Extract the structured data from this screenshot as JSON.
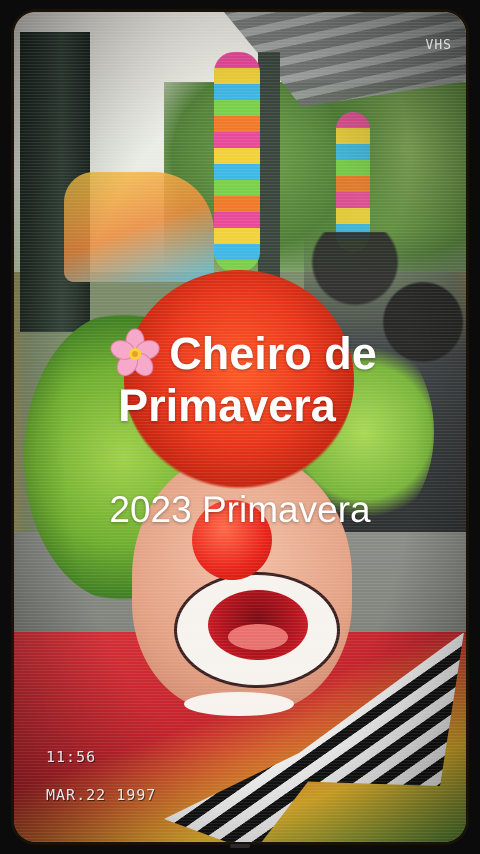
{
  "overlay": {
    "vhs_label": "VHS",
    "title_line1": "Cheiro de",
    "title_line2": "Primavera",
    "subtitle": "2023 Primavera",
    "stamp_time": "11:56",
    "stamp_date": "MAR.22 1997"
  },
  "icons": {
    "flower": "cherry-blossom-icon"
  },
  "colors": {
    "title_text": "#ffffff",
    "frame_glow": "#d6963c",
    "background": "#0b0b0b"
  }
}
